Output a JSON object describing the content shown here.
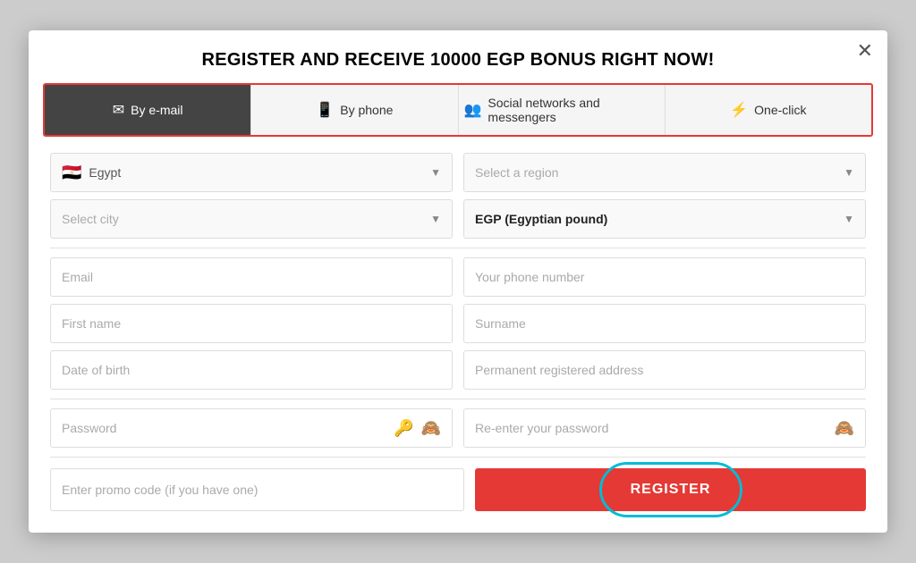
{
  "modal": {
    "title": "REGISTER AND RECEIVE 10000 EGP BONUS RIGHT NOW!",
    "close_label": "✕"
  },
  "tabs": [
    {
      "id": "email",
      "label": "By e-mail",
      "icon": "✉",
      "active": true
    },
    {
      "id": "phone",
      "label": "By phone",
      "icon": "📱",
      "active": false
    },
    {
      "id": "social",
      "label": "Social networks and messengers",
      "icon": "👥",
      "active": false
    },
    {
      "id": "oneclick",
      "label": "One-click",
      "icon": "⚡",
      "active": false
    }
  ],
  "form": {
    "country_value": "Egypt",
    "country_flag": "🇪🇬",
    "region_placeholder": "Select a region",
    "city_placeholder": "Select city",
    "currency_value": "EGP (Egyptian pound)",
    "email_placeholder": "Email",
    "phone_placeholder": "Your phone number",
    "firstname_placeholder": "First name",
    "surname_placeholder": "Surname",
    "dob_placeholder": "Date of birth",
    "address_placeholder": "Permanent registered address",
    "password_placeholder": "Password",
    "repassword_placeholder": "Re-enter your password",
    "promo_placeholder": "Enter promo code (if you have one)",
    "register_label": "REGISTER"
  }
}
